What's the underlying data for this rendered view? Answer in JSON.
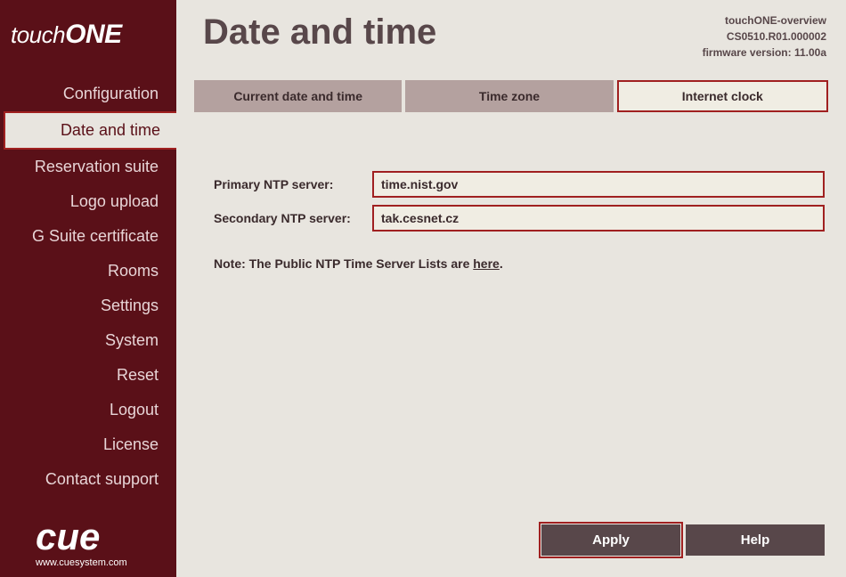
{
  "branding": {
    "logo_touch": "touch",
    "logo_one": "ONE",
    "footer_brand": "cue",
    "footer_url": "www.cuesystem.com"
  },
  "nav": {
    "items": [
      {
        "label": "Configuration"
      },
      {
        "label": "Date and time"
      },
      {
        "label": "Reservation suite"
      },
      {
        "label": "Logo upload"
      },
      {
        "label": "G Suite certificate"
      },
      {
        "label": "Rooms"
      },
      {
        "label": "Settings"
      },
      {
        "label": "System"
      },
      {
        "label": "Reset"
      },
      {
        "label": "Logout"
      },
      {
        "label": "License"
      },
      {
        "label": "Contact support"
      }
    ]
  },
  "header": {
    "title": "Date and time",
    "info": {
      "product": "touchONE-overview",
      "serial": "CS0510.R01.000002",
      "firmware": "firmware version: 11.00a"
    }
  },
  "tabs": [
    {
      "label": "Current date and time"
    },
    {
      "label": "Time zone"
    },
    {
      "label": "Internet clock"
    }
  ],
  "form": {
    "primary_label": "Primary NTP server:",
    "primary_value": "time.nist.gov",
    "secondary_label": "Secondary NTP server:",
    "secondary_value": "tak.cesnet.cz",
    "note_prefix": "Note: The Public NTP Time Server Lists are ",
    "note_link": "here",
    "note_suffix": "."
  },
  "buttons": {
    "apply": "Apply",
    "help": "Help"
  }
}
